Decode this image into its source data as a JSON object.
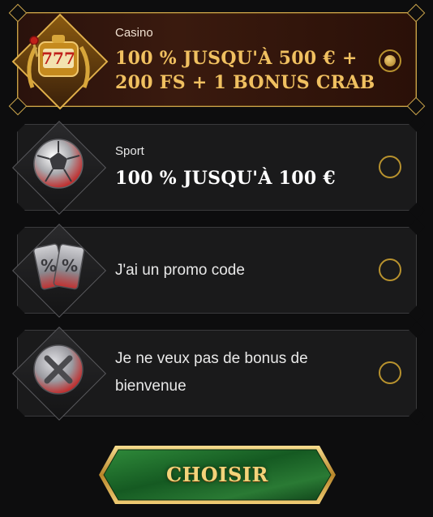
{
  "options": [
    {
      "category": "Casino",
      "title_line1": "100 % JUSQU'À 500 € +",
      "title_line2": "200 FS + 1 BONUS CRAB",
      "selected": true,
      "icon": "slot-777-icon",
      "title_color": "#f0c060"
    },
    {
      "category": "Sport",
      "title_line1": "100 % JUSQU'À 100 €",
      "selected": false,
      "icon": "football-icon",
      "title_color": "#ffffff"
    },
    {
      "label": "J'ai un promo code",
      "selected": false,
      "icon": "promo-tickets-icon"
    },
    {
      "label_line1": "Je ne veux pas de bonus de",
      "label_line2": "bienvenue",
      "selected": false,
      "icon": "no-bonus-x-icon"
    }
  ],
  "submit": {
    "label": "CHOISIR"
  },
  "colors": {
    "gold": "#c8a24a",
    "button_green": "#1f6a2a",
    "background": "#0d0d0e"
  }
}
